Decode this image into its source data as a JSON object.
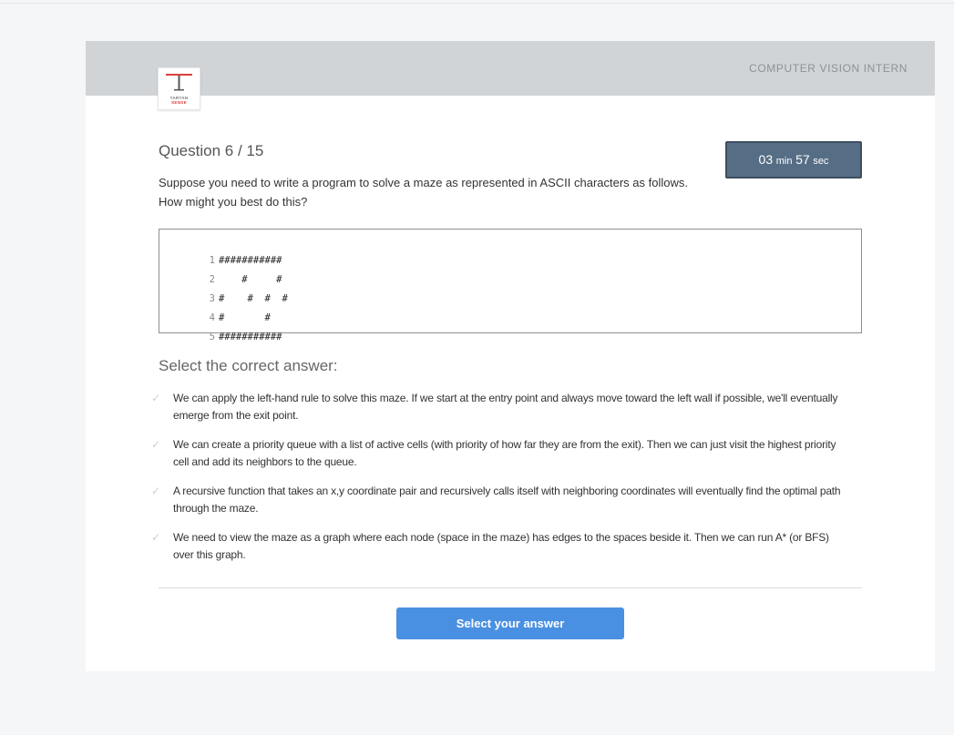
{
  "header": {
    "role_title": "COMPUTER VISION INTERN",
    "logo": {
      "line1": "TARTAN",
      "line2": "SENSE",
      "icon": "tartansense-t-logo"
    }
  },
  "question": {
    "number_label": "Question 6 / 15",
    "text_line1": "Suppose you need to write a program to solve a maze as represented in ASCII characters as follows.",
    "text_line2": "How might you best do this?"
  },
  "timer": {
    "minutes": "03",
    "min_label": "min",
    "seconds": "57",
    "sec_label": "sec"
  },
  "code": {
    "lines": [
      {
        "num": "1",
        "text": "###########"
      },
      {
        "num": "2",
        "text": "    #     #"
      },
      {
        "num": "3",
        "text": "#    #  #  #"
      },
      {
        "num": "4",
        "text": "#       #"
      },
      {
        "num": "5",
        "text": "###########"
      }
    ]
  },
  "answers": {
    "heading": "Select the correct answer:",
    "options": [
      {
        "text": "We can apply the left-hand rule to solve this maze. If we start at the entry point and always move toward the left wall if possible, we'll eventually emerge from the exit point."
      },
      {
        "text": "We can create a priority queue with a list of active cells (with priority of how far they are from the exit). Then we can just visit the highest priority cell and add its neighbors to the queue."
      },
      {
        "text": "A recursive function that takes an x,y coordinate pair and recursively calls itself with neighboring coordinates will eventually find the optimal path through the maze."
      },
      {
        "text": "We need to view the maze as a graph where each node (space in the maze) has edges to the spaces beside it. Then we can run A* (or BFS) over this graph."
      }
    ],
    "check_icon": "checkmark-icon"
  },
  "submit": {
    "label": "Select your answer"
  },
  "colors": {
    "header_bg": "#d1d4d7",
    "timer_bg": "#566e85",
    "button_bg": "#4a90e2",
    "logo_red": "#d9413c"
  }
}
